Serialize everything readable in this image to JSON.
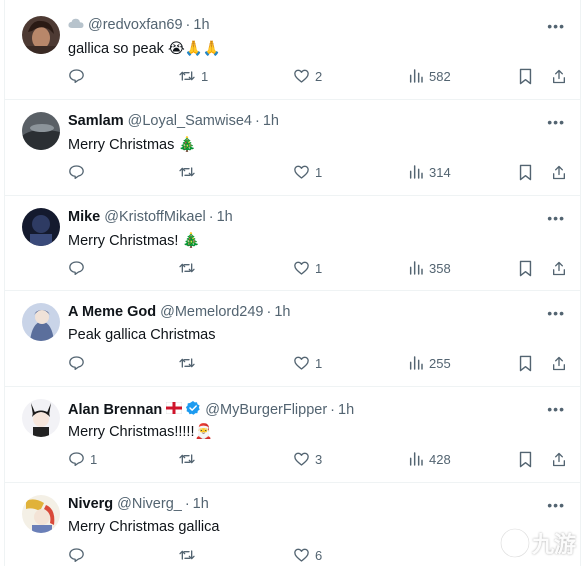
{
  "tweets": [
    {
      "name": "",
      "handle": "@redvoxfan69",
      "time": "1h",
      "text": "gallica so peak",
      "emoji": "😭🙏🙏",
      "prefix_icon": "cloud-icon",
      "replies": "",
      "retweets": "1",
      "likes": "2",
      "views": "582",
      "avatar_color": "#6b4a3a"
    },
    {
      "name": "Samlam",
      "handle": "@Loyal_Samwise4",
      "time": "1h",
      "text": "Merry Christmas",
      "emoji": "🎄",
      "replies": "",
      "retweets": "",
      "likes": "1",
      "views": "314",
      "avatar_color": "#3a3f44"
    },
    {
      "name": "Mike",
      "handle": "@KristoffMikael",
      "time": "1h",
      "text": "Merry Christmas!",
      "emoji": "🎄",
      "replies": "",
      "retweets": "",
      "likes": "1",
      "views": "358",
      "avatar_color": "#1f2a44"
    },
    {
      "name": "A Meme God",
      "handle": "@Memelord249",
      "time": "1h",
      "text": "Peak gallica Christmas",
      "emoji": "",
      "replies": "",
      "retweets": "",
      "likes": "1",
      "views": "255",
      "avatar_color": "#8fa3c7"
    },
    {
      "name": "Alan Brennan",
      "handle": "@MyBurgerFlipper",
      "time": "1h",
      "text": "Merry Christmas!!!!!",
      "emoji": "🎅",
      "flag": "england-flag",
      "verified": true,
      "replies": "1",
      "retweets": "",
      "likes": "3",
      "views": "428",
      "avatar_color": "#e9e9ef"
    },
    {
      "name": "Niverg",
      "handle": "@Niverg_",
      "time": "1h",
      "text": "Merry Christmas gallica",
      "emoji": "",
      "replies": "",
      "retweets": "",
      "likes": "6",
      "views": "",
      "avatar_color": "#d94a3a"
    }
  ],
  "ui": {
    "more_label": "•••",
    "separator": "·"
  },
  "colors": {
    "muted": "#536471",
    "text": "#0f1419",
    "verified": "#1d9bf0",
    "divider": "#eff3f4"
  },
  "watermark": {
    "text": "九游"
  }
}
